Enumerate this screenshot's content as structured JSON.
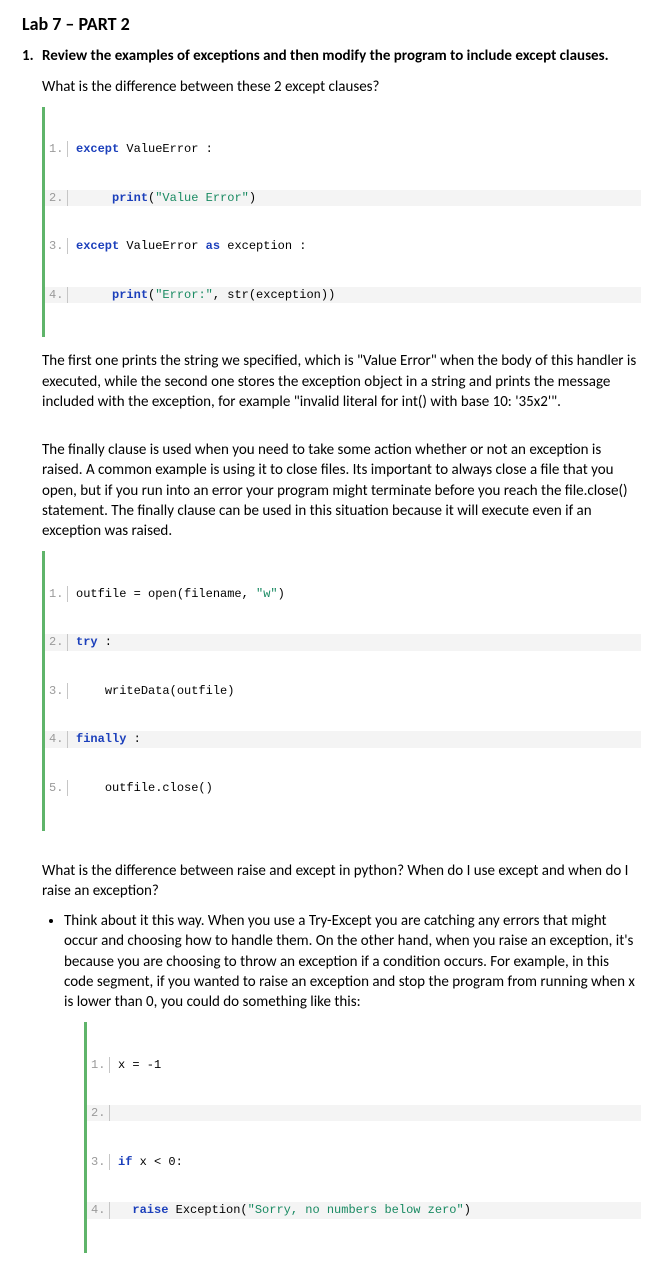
{
  "title": "Lab 7 – PART 2",
  "item_number": "1.",
  "lead_in": "Review the examples of exceptions and then modify the program to include except clauses.",
  "para_q1": "What is the difference between these 2 except clauses?",
  "codeA": {
    "l1_kw": "except",
    "l1_rest": " ValueError :",
    "l2_kw": "print",
    "l2_open": "(",
    "l2_str": "\"Value Error\"",
    "l2_close": ")",
    "l3_kwa": "except",
    "l3_mid": " ValueError ",
    "l3_kwb": "as",
    "l3_rest": " exception :",
    "l4_kw": "print",
    "l4_open": "(",
    "l4_str": "\"Error:\"",
    "l4_rest": ", str(exception))"
  },
  "para_a1": "The first one prints the string we specified, which is \"Value Error\" when the body of this handler is executed, while the second one stores the exception object in a string and prints the message included with the exception, for example \"invalid literal for int() with base 10: '35x2'\".",
  "para_finally": "The finally clause is used when you need to take some action whether or not an exception is raised. A common example is using it to close files. Its important to always close a file that you open, but if you run into an error your program might terminate before you reach the file.close() statement. The finally clause can be used in this situation because it will execute even if an exception was raised.",
  "codeB": {
    "l1_a": "outfile = open(filename, ",
    "l1_str": "\"w\"",
    "l1_b": ")",
    "l2_kw": "try",
    "l2_rest": " :",
    "l3": "writeData(outfile)",
    "l4_kw": "finally",
    "l4_rest": " :",
    "l5": "outfile.close()"
  },
  "para_q2": "What is the difference between raise and except in python? When do I use except and when do I raise an exception?",
  "bullet_text": "Think about it this way. When you use a Try-Except you are catching any errors that might occur and choosing how to handle them. On the other hand, when you raise an exception, it's because you are choosing to throw an exception if a condition occurs. For example, in this code segment, if you wanted to raise an exception and stop the program from running when x is lower than 0, you could do something like this:",
  "codeC": {
    "l1": "x = -1",
    "l3_kw": "if",
    "l3_rest": " x < 0:",
    "l4_kw": "raise",
    "l4_mid": " Exception(",
    "l4_str": "\"Sorry, no numbers below zero\"",
    "l4_end": ")"
  },
  "line_numbers": {
    "n1": "1.",
    "n2": "2.",
    "n3": "3.",
    "n4": "4.",
    "n5": "5."
  }
}
